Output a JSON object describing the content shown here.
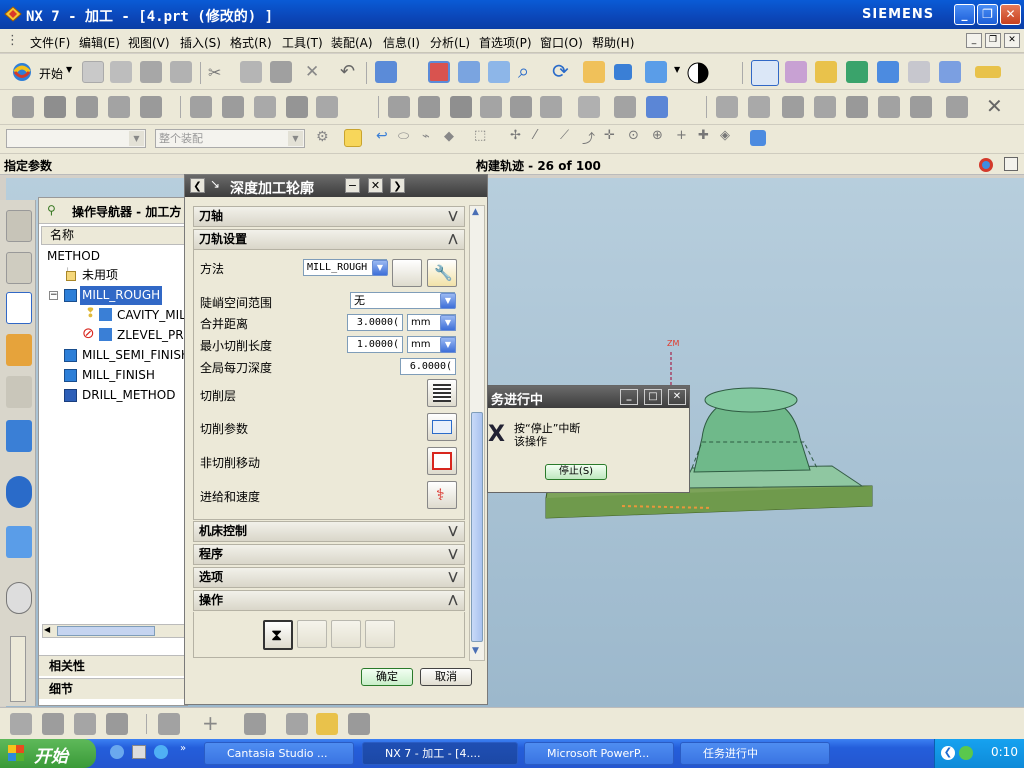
{
  "titlebar": {
    "title": "NX 7 - 加工 - [4.prt  (修改的) ]",
    "brand": "SIEMENS"
  },
  "menu": [
    "文件(F)",
    "编辑(E)",
    "视图(V)",
    "插入(S)",
    "格式(R)",
    "工具(T)",
    "装配(A)",
    "信息(I)",
    "分析(L)",
    "首选项(P)",
    "窗口(O)",
    "帮助(H)"
  ],
  "toolbar": {
    "start_label": "开始",
    "assembly_filter": "整个装配"
  },
  "status": {
    "left": "指定参数",
    "center": "构建轨迹 - 26 of 100"
  },
  "navigator": {
    "title": "操作导航器 - 加工方",
    "column": "名称",
    "root": "METHOD",
    "items": [
      {
        "label": "未用项",
        "icon": "folder-icon"
      },
      {
        "label": "MILL_ROUGH",
        "icon": "method-icon",
        "selected": true
      },
      {
        "label": "CAVITY_MIL",
        "icon": "operation-icon",
        "status": "pending"
      },
      {
        "label": "ZLEVEL_PRO",
        "icon": "operation-icon",
        "status": "blocked"
      },
      {
        "label": "MILL_SEMI_FINISH",
        "icon": "method-icon"
      },
      {
        "label": "MILL_FINISH",
        "icon": "method-icon"
      },
      {
        "label": "DRILL_METHOD",
        "icon": "drill-method-icon"
      }
    ],
    "panels": [
      "相关性",
      "细节"
    ]
  },
  "dialog": {
    "title": "深度加工轮廓",
    "sections": {
      "tool_axis": "刀轴",
      "path_settings": "刀轨设置",
      "machine_control": "机床控制",
      "program": "程序",
      "options": "选项",
      "operation": "操作"
    },
    "method_label": "方法",
    "method_value": "MILL_ROUGH",
    "steep_label": "陡峭空间范围",
    "steep_value": "无",
    "merge_label": "合并距离",
    "merge_value": "3.0000(",
    "merge_unit": "mm",
    "min_cut_label": "最小切削长度",
    "min_cut_value": "1.0000(",
    "min_cut_unit": "mm",
    "depth_label": "全局每刀深度",
    "depth_value": "6.0000(",
    "cut_levels_label": "切削层",
    "cut_params_label": "切削参数",
    "noncut_label": "非切削移动",
    "feeds_label": "进给和速度",
    "ok": "确定",
    "cancel": "取消"
  },
  "progress": {
    "title": "务进行中",
    "message_line1": "按“停止”中断",
    "message_line2": "该操作",
    "stop": "停止(S)"
  },
  "model": {
    "axis_label": "ZM"
  },
  "taskbar": {
    "start": "开始",
    "tasks": [
      "Cantasia Studio ...",
      "NX 7 - 加工 - [4....",
      "Microsoft PowerP...",
      "任务进行中"
    ],
    "clock": "0:10"
  },
  "colors": {
    "title_blue": "#0b46b8",
    "selection": "#3168c6",
    "model_green": "#6fb98a",
    "taskbar_blue": "#245edb"
  }
}
